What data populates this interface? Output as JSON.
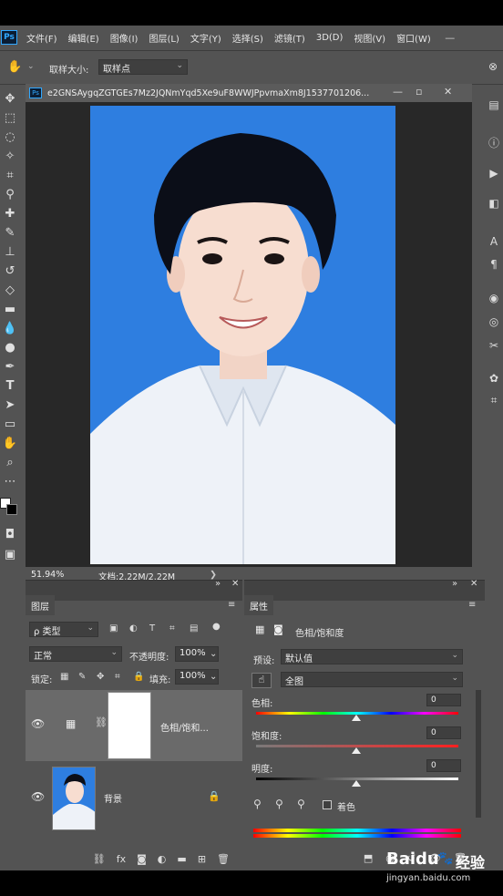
{
  "menubar": {
    "logo": "Ps",
    "items": [
      "文件(F)",
      "编辑(E)",
      "图像(I)",
      "图层(L)",
      "文字(Y)",
      "选择(S)",
      "滤镜(T)",
      "3D(D)",
      "视图(V)",
      "窗口(W)"
    ],
    "window_controls": [
      "—",
      "▫",
      "✕"
    ]
  },
  "options_bar": {
    "tool_icon": "hand-icon",
    "sample_size_label": "取样大小:",
    "sample_size_value": "取样点"
  },
  "document": {
    "logo": "Ps",
    "title": "e2GNSAygqZGTGEs7Mz2JQNmYqd5Xe9uF8WWJPpvmaXm8J1537701206...",
    "zoom": "51.94%",
    "doc_info": "文档:2.22M/2.22M",
    "nav_arrow": "❯",
    "canvas_bg_color": "#2e7ee0"
  },
  "layers_panel": {
    "tab_label": "图层",
    "filter_label": "ρ 类型",
    "blend_mode": "正常",
    "opacity_label": "不透明度:",
    "opacity_value": "100%",
    "lock_label": "锁定:",
    "fill_label": "填充:",
    "fill_value": "100%",
    "layers": [
      {
        "name": "色相/饱和...",
        "type": "adjustment"
      },
      {
        "name": "背景",
        "type": "image"
      }
    ]
  },
  "properties_panel": {
    "tab_label": "属性",
    "adjustment_title": "色相/饱和度",
    "preset_label": "预设:",
    "preset_value": "默认值",
    "channel_value": "全图",
    "hue_label": "色相:",
    "hue_value": "0",
    "saturation_label": "饱和度:",
    "saturation_value": "0",
    "lightness_label": "明度:",
    "lightness_value": "0",
    "colorize_label": "着色"
  },
  "watermark": {
    "brand": "Baidu",
    "brand_cn": "经验",
    "url": "jingyan.baidu.com"
  }
}
